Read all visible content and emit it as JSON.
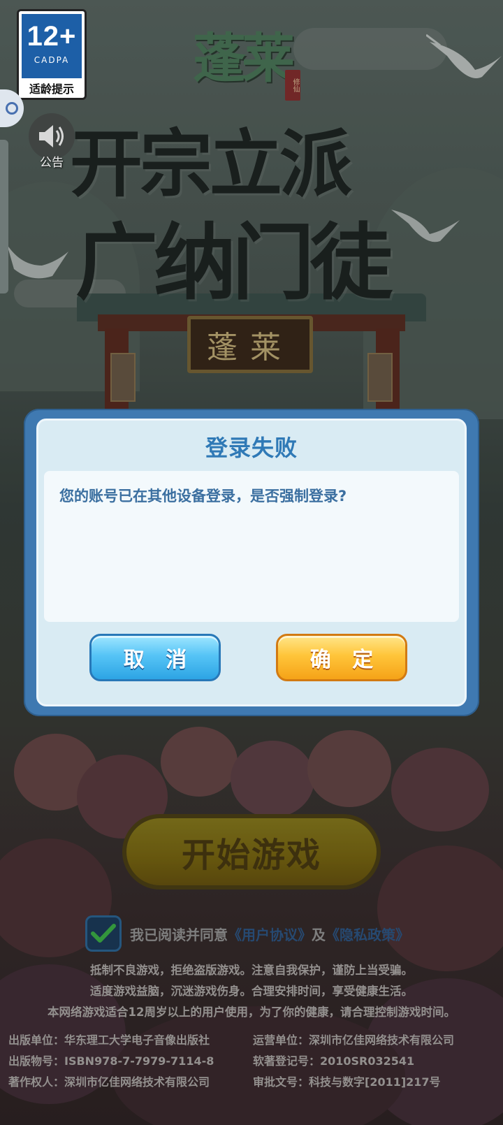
{
  "age_rating": {
    "number": "12+",
    "org": "CADPA",
    "label": "适龄提示"
  },
  "notice": {
    "label": "公告"
  },
  "logo": {
    "title": "蓬莱",
    "seal": "修仙"
  },
  "slogan": {
    "line1": "开宗立派",
    "line2": "广纳门徒"
  },
  "gate": {
    "plaque": "蓬莱"
  },
  "dialog": {
    "title": "登录失败",
    "message": "您的账号已在其他设备登录，是否强制登录?",
    "cancel_label": "取 消",
    "confirm_label": "确 定"
  },
  "start_button": {
    "label": "开始游戏"
  },
  "agreement": {
    "checked": true,
    "text": "我已阅读并同意",
    "user_agreement": "《用户协议》",
    "and": "及",
    "privacy_policy": "《隐私政策》"
  },
  "footer": {
    "line1": "抵制不良游戏，拒绝盗版游戏。注意自我保护，谨防上当受骗。",
    "line2": "适度游戏益脑，沉迷游戏伤身。合理安排时间，享受健康生活。",
    "line3": "本网络游戏适合12周岁以上的用户使用，为了你的健康，请合理控制游戏时间。",
    "publisher": "出版单位：华东理工大学电子音像出版社",
    "operator": "运营单位：深圳市亿佳网络技术有限公司",
    "isbn": "出版物号：ISBN978-7-7979-7114-8",
    "software_reg": "软著登记号：2010SR032541",
    "copyright_owner": "著作权人：深圳市亿佳网络技术有限公司",
    "approval": "审批文号：科技与数字[2011]217号"
  },
  "colors": {
    "dialog_frame": "#3f79b1",
    "dialog_title": "#2f79b6",
    "cancel_button": "#56c4f6",
    "confirm_button": "#ffc53a"
  }
}
